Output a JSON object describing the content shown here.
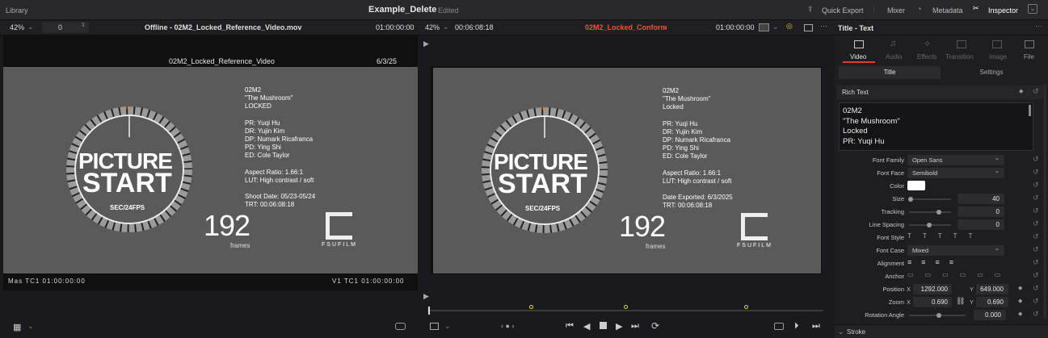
{
  "topbar": {
    "library": "Library",
    "project": "Example_Delete",
    "status": "Edited",
    "quick_export": "Quick Export",
    "mixer": "Mixer",
    "metadata": "Metadata",
    "inspector": "Inspector"
  },
  "source": {
    "zoom": "42%",
    "frame_field": "0",
    "clip_title": "Offline - 02M2_Locked_Reference_Video.mov",
    "timecode": "01:00:00:00",
    "overlay_name": "02M2_Locked_Reference_Video",
    "overlay_date": "6/3/25",
    "footer_left": "Mas  TC1   01:00:00:00",
    "footer_right": "V1 TC1   01:00:00:00"
  },
  "timeline": {
    "zoom": "42%",
    "duration": "00:06:08:18",
    "name": "02M2_Locked_Conform",
    "timecode": "01:00:00:00"
  },
  "leader": {
    "number_top": "00",
    "line1": "PICTURE",
    "line2": "START",
    "fps": "SEC/24FPS",
    "frames": "192",
    "frames_label": "frames",
    "logo_text": "FSUFILM"
  },
  "left_meta": [
    "02M2",
    "\"The Mushroom\"",
    "LOCKED",
    "",
    "PR: Yuqi Hu",
    "DR: Yujin Kim",
    "DP: Numark Ricafranca",
    "PD: Ying Shi",
    "ED: Cole Taylor",
    "",
    "Aspect Ratio: 1.66:1",
    "LUT: High contrast / soft",
    "",
    "Shoot Date: 05/23-05/24",
    "TRT: 00:06:08:18"
  ],
  "right_meta": [
    "02M2",
    "\"The Mushroom\"",
    "Locked",
    "",
    "PR: Yuqi Hu",
    "DR: Yujin Kim",
    "DP: Numark Ricafranca",
    "PD: Ying Shi",
    "ED: Cole Taylor",
    "",
    "Aspect Ratio: 1.66:1",
    "LUT: High contrast / soft",
    "",
    "Date Exported: 6/3/2025",
    "TRT: 00:06:08:18"
  ],
  "inspector": {
    "title": "Title - Text",
    "tabs": [
      "Video",
      "Audio",
      "Effects",
      "Transition",
      "Image",
      "File"
    ],
    "subtabs": [
      "Title",
      "Settings"
    ],
    "rich_text_label": "Rich Text",
    "rich_text_lines": [
      "02M2",
      "\"The Mushroom\"",
      "Locked",
      "PR: Yuqi Hu"
    ],
    "font_family_label": "Font Family",
    "font_family": "Open Sans",
    "font_face_label": "Font Face",
    "font_face": "Semibold",
    "color_label": "Color",
    "size_label": "Size",
    "size": "40",
    "tracking_label": "Tracking",
    "tracking": "0",
    "line_spacing_label": "Line Spacing",
    "line_spacing": "0",
    "font_style_label": "Font Style",
    "font_case_label": "Font Case",
    "font_case": "Mixed",
    "alignment_label": "Alignment",
    "anchor_label": "Anchor",
    "position_label": "Position",
    "pos_x": "1292.000",
    "pos_y": "649.000",
    "zoom_label": "Zoom",
    "zoom_x": "0.690",
    "zoom_y": "0.690",
    "rotation_label": "Rotation Angle",
    "rotation": "0.000",
    "stroke_label": "Stroke",
    "x_label": "X",
    "y_label": "Y"
  },
  "colors": {
    "accent_red": "#e0402a",
    "timeline_name": "#e8553a"
  }
}
